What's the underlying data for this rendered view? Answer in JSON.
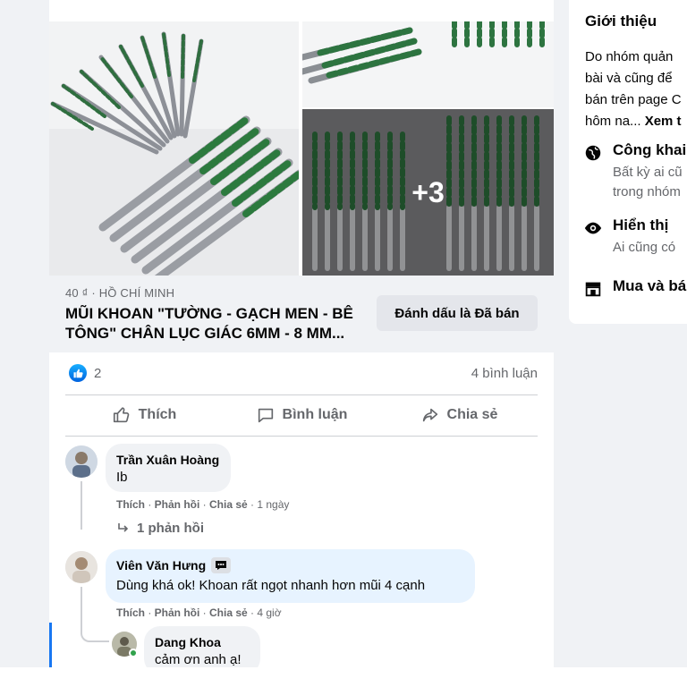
{
  "listing": {
    "price_location": "40 ₫ · HỒ CHÍ MINH",
    "title_line1": "MŨI KHOAN \"TƯỜNG - GẠCH MEN - BÊ",
    "title_line2": "TÔNG\" CHÂN LỤC GIÁC 6MM - 8 MM...",
    "mark_sold_label": "Đánh dấu là Đã bán",
    "more_photos": "+3"
  },
  "reactions": {
    "count": "2",
    "comments": "4 bình luận"
  },
  "actions": {
    "like": "Thích",
    "comment": "Bình luận",
    "share": "Chia sẻ"
  },
  "comments": [
    {
      "author": "Trần Xuân Hoàng",
      "text": "Ib",
      "like": "Thích",
      "reply": "Phản hồi",
      "share": "Chia sẻ",
      "time": "1 ngày",
      "view_replies": "1 phản hồi"
    },
    {
      "author": "Viên Văn Hưng",
      "text": "Dùng khá ok! Khoan rất ngọt nhanh hơn mũi 4 cạnh",
      "like": "Thích",
      "reply": "Phản hồi",
      "share": "Chia sẻ",
      "time": "4 giờ"
    },
    {
      "author": "Dang Khoa",
      "text": "cảm ơn anh ạ!"
    }
  ],
  "about": {
    "title": "Giới thiệu",
    "desc_line1": "Do nhóm quản",
    "desc_line2": "bài và cũng để",
    "desc_line3": "bán trên page C",
    "desc_line4_prefix": "hôm na... ",
    "see_more": "Xem t",
    "public_label": "Công khai",
    "public_sub1": "Bất kỳ ai cũ",
    "public_sub2": "trong nhóm",
    "visible_label": "Hiển thị",
    "visible_sub": "Ai cũng có",
    "buysell_label": "Mua và bá"
  },
  "colors": {
    "accent": "#1877f2",
    "secondary_text": "#65676b",
    "background": "#f0f2f5"
  }
}
